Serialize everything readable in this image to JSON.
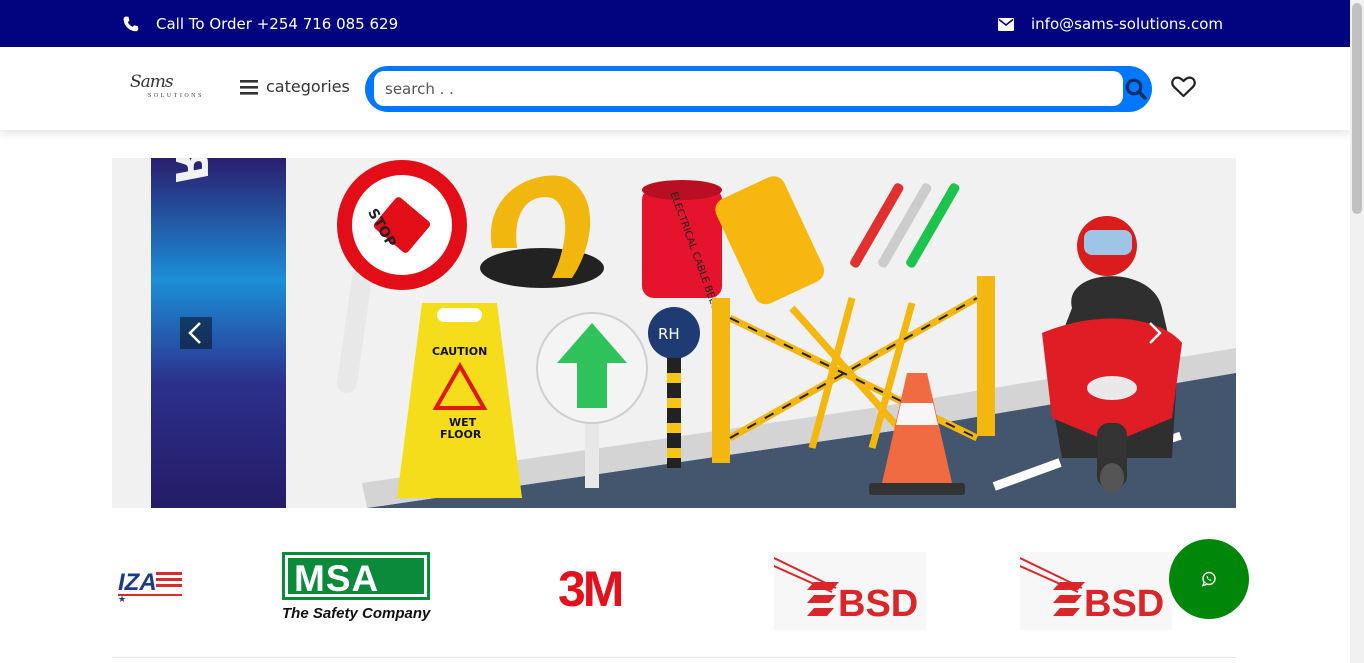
{
  "topbar": {
    "phone_text": "Call To Order +254 716 085 629",
    "email_text": "info@sams-solutions.com",
    "background": "#01047e",
    "phone_icon": "phone-icon",
    "mail_icon": "envelope-icon"
  },
  "header": {
    "logo_script": "Sams",
    "logo_sub": "SOLUTIONS",
    "categories_label": "categories",
    "search_placeholder": "search . .",
    "search_accent": "#0077ff",
    "search_icon": "search-icon",
    "wishlist_icon": "heart-icon"
  },
  "banner": {
    "vertical_text": "ROAD SAFETY",
    "sign_stop": "STOP",
    "sign_caution": "CAUTION",
    "sign_wet_floor_1": "WET",
    "sign_wet_floor_2": "FLOOR",
    "tape_text": "ELECTRICAL CABLE BELOW",
    "sign_rh": "RH",
    "prev_icon": "chevron-left-icon",
    "next_icon": "chevron-right-icon"
  },
  "brands": {
    "items": [
      {
        "name": "IZA",
        "text": "IZA"
      },
      {
        "name": "MSA",
        "text": "MSA",
        "tagline": "The Safety Company"
      },
      {
        "name": "3M",
        "text": "3M"
      },
      {
        "name": "BSD",
        "text": "BSD"
      },
      {
        "name": "BSD",
        "text": "BSD"
      }
    ]
  },
  "whatsapp": {
    "icon": "whatsapp-icon",
    "color": "#00870a"
  }
}
